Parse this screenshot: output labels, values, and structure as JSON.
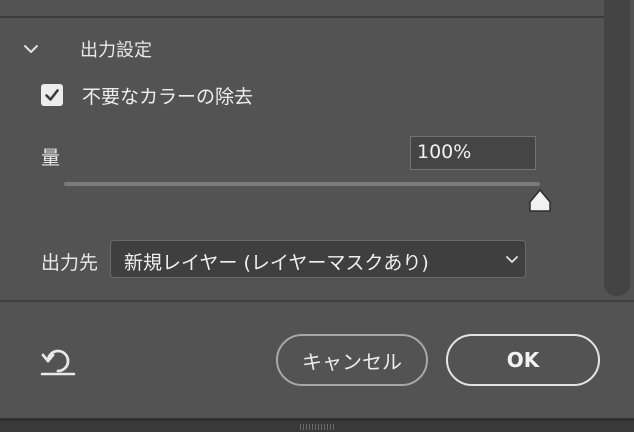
{
  "section": {
    "title": "出力設定"
  },
  "checkbox": {
    "label": "不要なカラーの除去",
    "checked": true
  },
  "amount": {
    "label": "量",
    "value": "100%",
    "slider_fraction": 1.0
  },
  "output": {
    "label": "出力先",
    "selected": "新規レイヤー (レイヤーマスクあり)"
  },
  "footer": {
    "cancel_label": "キャンセル",
    "ok_label": "OK"
  },
  "icons": {
    "collapse": "chevron-down-icon",
    "check": "checkmark-icon",
    "select_dropdown": "chevron-down-icon",
    "reset": "reset-icon",
    "resize": "resize-grip-icon"
  },
  "colors": {
    "panel_bg": "#535353",
    "field_bg": "#454545",
    "text": "#e8e8e8"
  }
}
